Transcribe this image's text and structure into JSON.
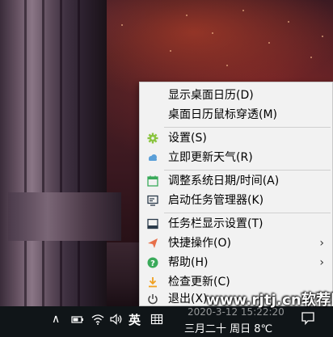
{
  "menu": {
    "items": [
      {
        "label": "显示桌面日历(D)",
        "icon": "none"
      },
      {
        "label": "桌面日历鼠标穿透(M)",
        "icon": "none"
      },
      {
        "label": "设置(S)",
        "icon": "gear-icon"
      },
      {
        "label": "立即更新天气(R)",
        "icon": "cloud-icon"
      },
      {
        "label": "调整系统日期/时间(A)",
        "icon": "calendar-icon"
      },
      {
        "label": "启动任务管理器(K)",
        "icon": "monitor-icon"
      },
      {
        "label": "任务栏显示设置(T)",
        "icon": "taskbar-icon"
      },
      {
        "label": "快捷操作(O)",
        "icon": "paper-plane-icon",
        "submenu": true
      },
      {
        "label": "帮助(H)",
        "icon": "help-icon",
        "submenu": true
      },
      {
        "label": "检查更新(C)",
        "icon": "download-icon"
      },
      {
        "label": "退出(X)",
        "icon": "power-icon"
      }
    ],
    "submenu_arrow": "›"
  },
  "taskbar": {
    "chevron": "∧",
    "ime": "英",
    "clock_time": "2020-3-12 15:22:20",
    "clock_date": "三月二十 周日 8℃",
    "notification_icon": "notification-icon"
  },
  "watermark": "www.rjtj.cn软荐网",
  "colors": {
    "menu_bg": "#f2f2f2",
    "gear": "#8ac43f",
    "cloud": "#5a9fd8",
    "calendar": "#3aaa5a",
    "paper_plane": "#e8704a",
    "help": "#3aaa5a",
    "download": "#f0a020"
  }
}
